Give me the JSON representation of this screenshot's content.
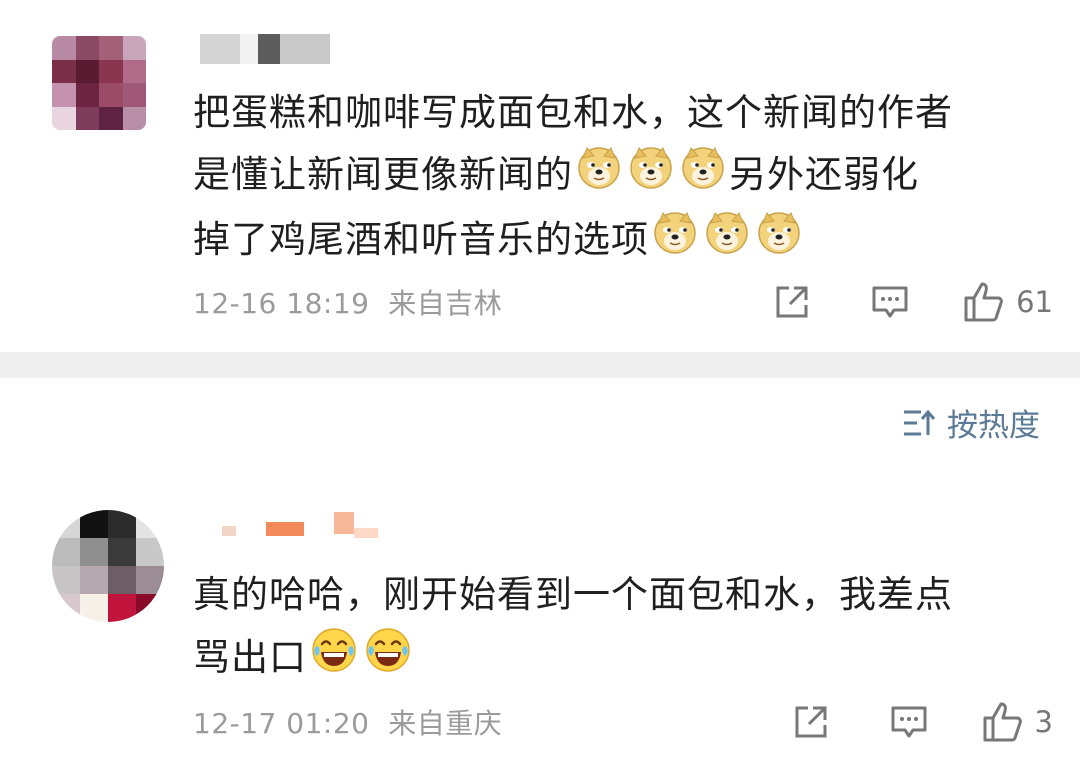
{
  "comments": [
    {
      "text_lines": [
        "把蛋糕和咖啡写成面包和水，这个新闻的作者",
        "是懂让新闻更像新闻的",
        "另外还弱化",
        "掉了鸡尾酒和听音乐的选项"
      ],
      "time": "12-16 18:19",
      "location": "来自吉林",
      "likes": "61",
      "emojis": [
        "doge",
        "doge",
        "doge",
        "doge",
        "doge",
        "doge"
      ]
    },
    {
      "text_line1": "真的哈哈，刚开始看到一个面包和水，我差点",
      "text_line2": "骂出口",
      "time": "12-17 01:20",
      "location": "来自重庆",
      "likes": "3",
      "emojis": [
        "laugh-cry",
        "laugh-cry"
      ]
    }
  ],
  "sort": {
    "label": "按热度"
  },
  "colors": {
    "divider": "#efefef",
    "meta": "#9b9b9b",
    "sort": "#5b7a96"
  }
}
